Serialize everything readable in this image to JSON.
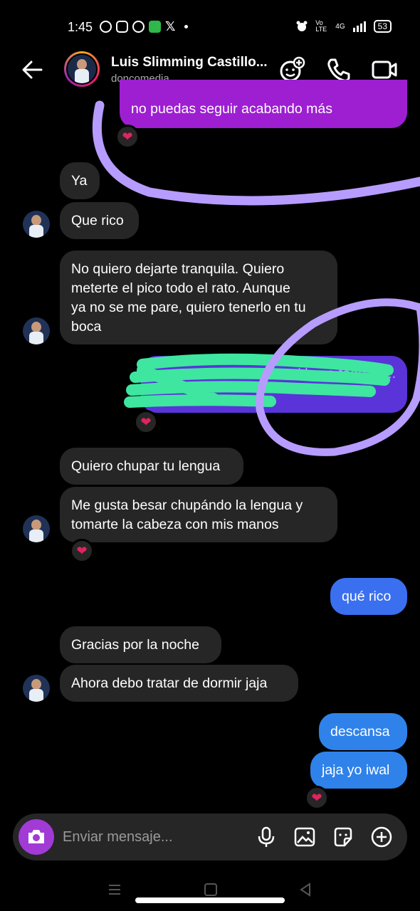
{
  "status_bar": {
    "time": "1:45",
    "network_label": "Vo LTE",
    "signal_label": "4G",
    "battery": "53"
  },
  "header": {
    "name": "Luis Slimming Castillo...",
    "username": "doncomedia"
  },
  "messages": [
    {
      "id": "m0",
      "side": "out",
      "text": "no puedas seguir acabando más"
    },
    {
      "id": "m1",
      "side": "in",
      "text": "Ya"
    },
    {
      "id": "m2",
      "side": "in",
      "text": "Que rico"
    },
    {
      "id": "m3",
      "side": "in",
      "lines": [
        "No quiero dejarte tranquila. Quiero",
        "meterte el pico todo el rato. Aunque",
        "ya no se me pare, quiero tenerlo en tu",
        "boca"
      ]
    },
    {
      "id": "m4",
      "side": "out",
      "text": "...trás mi ... mi boca todo el ..."
    },
    {
      "id": "m5",
      "side": "in",
      "text": "Quiero chupar tu lengua"
    },
    {
      "id": "m6",
      "side": "in",
      "lines": [
        "Me gusta besar chupándo la lengua y",
        "tomarte la cabeza con mis manos"
      ]
    },
    {
      "id": "m7",
      "side": "out",
      "text": "qué rico"
    },
    {
      "id": "m8",
      "side": "in",
      "text": "Gracias por la noche"
    },
    {
      "id": "m9",
      "side": "in",
      "text": "Ahora debo tratar de dormir jaja"
    },
    {
      "id": "m10",
      "side": "out",
      "text": "descansa"
    },
    {
      "id": "m11",
      "side": "out",
      "text": "jaja yo iwal"
    }
  ],
  "reaction": "❤",
  "composer": {
    "placeholder": "Enviar mensaje..."
  },
  "colors": {
    "accent_purple": "#9d1fd1",
    "accent_blue": "#3a6ff0",
    "incoming_bubble": "#262626",
    "annotation_stroke": "#b79cff",
    "scribble": "#3ee6a0"
  },
  "icons": [
    "back-arrow-icon",
    "add-effect-icon",
    "phone-icon",
    "video-camera-icon",
    "camera-icon",
    "microphone-icon",
    "gallery-icon",
    "sticker-icon",
    "plus-icon",
    "heart-icon"
  ]
}
